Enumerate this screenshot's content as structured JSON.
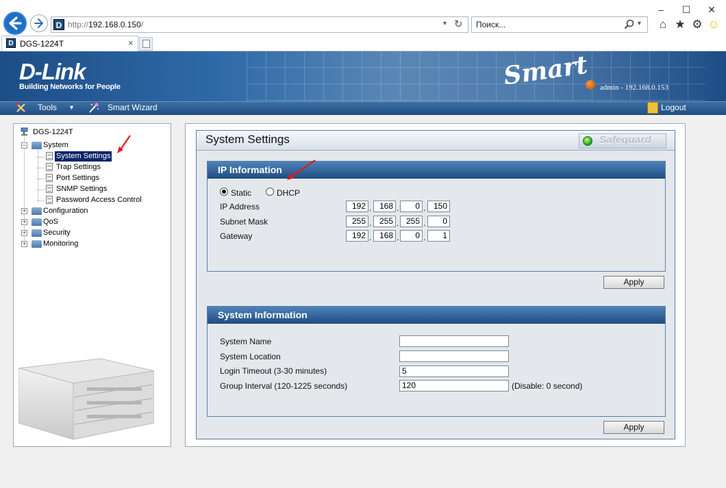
{
  "browser": {
    "url_scheme": "http://",
    "url_host": "192.168.0.150",
    "url_rest": "/",
    "search_placeholder": "Поиск...",
    "tab_title": "DGS-1224T",
    "window_controls": [
      "–",
      "☐",
      "✕"
    ]
  },
  "banner": {
    "logo": "D-Link",
    "tagline": "Building Networks for People",
    "product": "Smart",
    "admin": "admin - 192.168.0.153"
  },
  "menu": {
    "tools": "Tools",
    "smart_wizard": "Smart Wizard",
    "logout": "Logout"
  },
  "tree": {
    "root": "DGS-1224T",
    "system": "System",
    "system_children": [
      "System Settings",
      "Trap Settings",
      "Port Settings",
      "SNMP Settings",
      "Password Access Control"
    ],
    "selected": "System Settings",
    "folders": [
      "Configuration",
      "QoS",
      "Security",
      "Monitoring"
    ]
  },
  "page": {
    "title": "System Settings",
    "safeguard": "Safeguard"
  },
  "ip_info": {
    "heading": "IP Information",
    "mode_static": "Static",
    "mode_dhcp": "DHCP",
    "selected_mode": "Static",
    "ip_label": "IP Address",
    "ip": [
      "192",
      "168",
      "0",
      "150"
    ],
    "mask_label": "Subnet Mask",
    "mask": [
      "255",
      "255",
      "255",
      "0"
    ],
    "gw_label": "Gateway",
    "gateway": [
      "192",
      "168",
      "0",
      "1"
    ],
    "apply": "Apply"
  },
  "sys_info": {
    "heading": "System Information",
    "name_label": "System Name",
    "name_value": "",
    "location_label": "System Location",
    "location_value": "",
    "timeout_label": "Login Timeout (3-30 minutes)",
    "timeout_value": "5",
    "group_label": "Group Interval (120-1225 seconds)",
    "group_value": "120",
    "group_hint": "(Disable: 0 second)",
    "apply": "Apply"
  }
}
